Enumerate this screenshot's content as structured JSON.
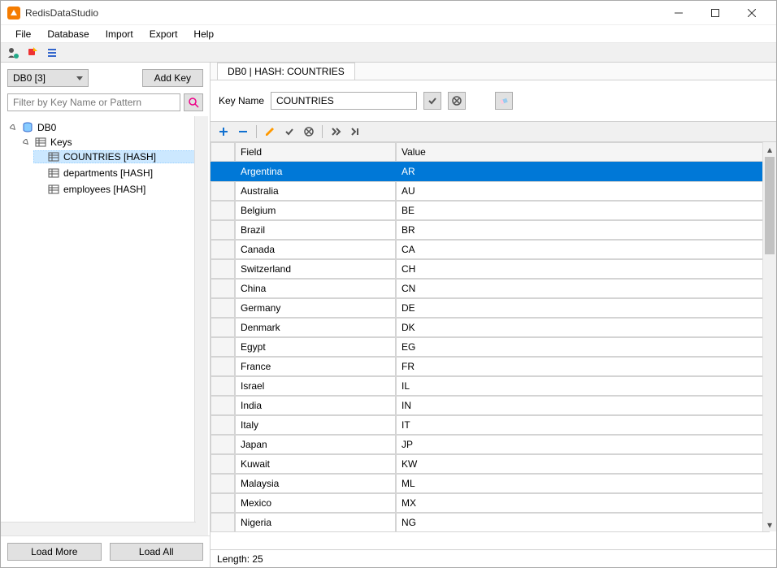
{
  "window": {
    "title": "RedisDataStudio"
  },
  "menu": {
    "file": "File",
    "database": "Database",
    "import": "Import",
    "export": "Export",
    "help": "Help"
  },
  "sidebar": {
    "db_selector": "DB0 [3]",
    "add_key": "Add Key",
    "filter_placeholder": "Filter by Key Name or Pattern",
    "load_more": "Load More",
    "load_all": "Load All",
    "tree": {
      "db": "DB0",
      "keys_label": "Keys",
      "items": [
        {
          "label": "COUNTRIES [HASH]"
        },
        {
          "label": "departments [HASH]"
        },
        {
          "label": "employees [HASH]"
        }
      ]
    }
  },
  "content": {
    "tab_label": "DB0 | HASH: COUNTRIES",
    "key_name_label": "Key Name",
    "key_name_value": "COUNTRIES",
    "table": {
      "field_header": "Field",
      "value_header": "Value",
      "rows": [
        {
          "field": "Argentina",
          "value": "AR"
        },
        {
          "field": "Australia",
          "value": "AU"
        },
        {
          "field": "Belgium",
          "value": "BE"
        },
        {
          "field": "Brazil",
          "value": "BR"
        },
        {
          "field": "Canada",
          "value": "CA"
        },
        {
          "field": "Switzerland",
          "value": "CH"
        },
        {
          "field": "China",
          "value": "CN"
        },
        {
          "field": "Germany",
          "value": "DE"
        },
        {
          "field": "Denmark",
          "value": "DK"
        },
        {
          "field": "Egypt",
          "value": "EG"
        },
        {
          "field": "France",
          "value": "FR"
        },
        {
          "field": "Israel",
          "value": "IL"
        },
        {
          "field": "India",
          "value": "IN"
        },
        {
          "field": "Italy",
          "value": "IT"
        },
        {
          "field": "Japan",
          "value": "JP"
        },
        {
          "field": "Kuwait",
          "value": "KW"
        },
        {
          "field": "Malaysia",
          "value": "ML"
        },
        {
          "field": "Mexico",
          "value": "MX"
        },
        {
          "field": "Nigeria",
          "value": "NG"
        }
      ],
      "selected_index": 0
    },
    "status": "Length: 25"
  }
}
